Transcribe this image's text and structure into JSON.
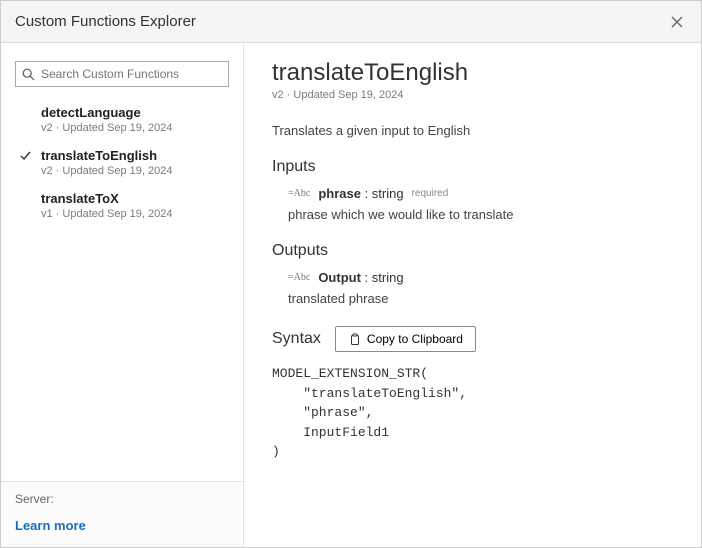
{
  "window": {
    "title": "Custom Functions Explorer"
  },
  "search": {
    "placeholder": "Search Custom Functions"
  },
  "functions": [
    {
      "name": "detectLanguage",
      "meta": "v2 · Updated Sep 19, 2024",
      "selected": false
    },
    {
      "name": "translateToEnglish",
      "meta": "v2 · Updated Sep 19, 2024",
      "selected": true
    },
    {
      "name": "translateToX",
      "meta": "v1 · Updated Sep 19, 2024",
      "selected": false
    }
  ],
  "footer": {
    "server_label": "Server:",
    "learn_more": "Learn more"
  },
  "detail": {
    "title": "translateToEnglish",
    "meta": "v2 · Updated Sep 19, 2024",
    "description": "Translates a given input to English",
    "inputs_heading": "Inputs",
    "input": {
      "name": "phrase",
      "type": ": string",
      "required": "required",
      "desc": "phrase which we would like to translate"
    },
    "outputs_heading": "Outputs",
    "output": {
      "name": "Output",
      "type": ": string",
      "desc": "translated phrase"
    },
    "syntax_heading": "Syntax",
    "copy_label": "Copy to Clipboard",
    "code": "MODEL_EXTENSION_STR(\n    \"translateToEnglish\",\n    \"phrase\",\n    InputField1\n)"
  }
}
